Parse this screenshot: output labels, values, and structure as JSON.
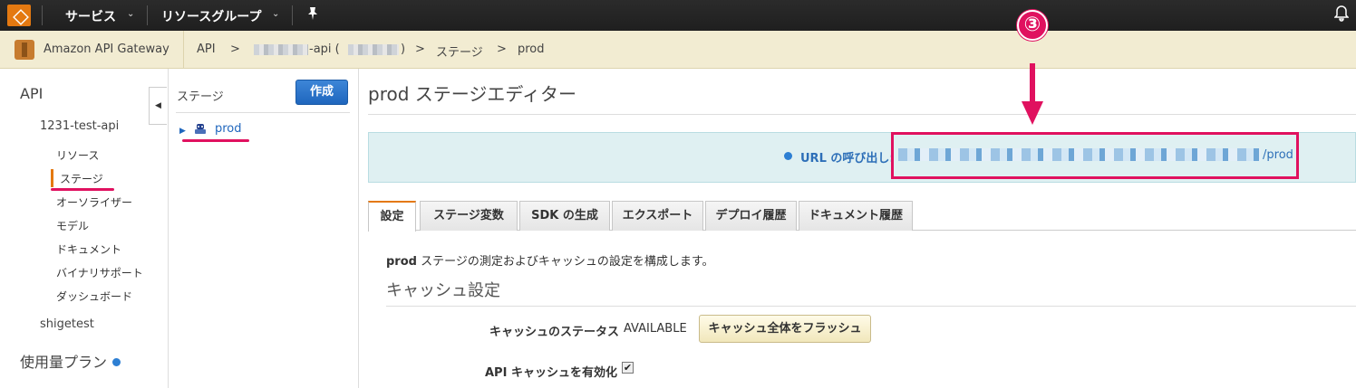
{
  "topnav": {
    "services_label": "サービス",
    "resource_groups_label": "リソースグループ",
    "chevron": "⌄",
    "pin_icon": "pin-icon",
    "bell_icon": "bell-icon"
  },
  "breadcrumb": {
    "service_name": "Amazon API Gateway",
    "items": [
      "API",
      ">",
      "-api (",
      ")",
      ">",
      "ステージ",
      ">",
      "prod"
    ]
  },
  "sidebar": {
    "section_api": "API",
    "api_name": "1231-test-api",
    "items": [
      {
        "label": "リソース"
      },
      {
        "label": "ステージ"
      },
      {
        "label": "オーソライザー"
      },
      {
        "label": "モデル"
      },
      {
        "label": "ドキュメント"
      },
      {
        "label": "バイナリサポート"
      },
      {
        "label": "ダッシュボード"
      }
    ],
    "other_api": "shigetest",
    "usage_plans": "使用量プラン",
    "collapse_glyph": "◀"
  },
  "stages": {
    "title": "ステージ",
    "create_label": "作成",
    "tree": [
      {
        "label": "prod"
      }
    ]
  },
  "main": {
    "title": "prod ステージエディター",
    "url": {
      "label": "URL の呼び出し:",
      "suffix": "/prod"
    },
    "annotation_number": "③",
    "tabs": [
      {
        "label": "設定",
        "active": true
      },
      {
        "label": "ステージ変数"
      },
      {
        "label": "SDK の生成"
      },
      {
        "label": "エクスポート"
      },
      {
        "label": "デプロイ履歴"
      },
      {
        "label": "ドキュメント履歴"
      }
    ],
    "description_bold": "prod",
    "description_rest": " ステージの測定およびキャッシュの設定を構成します。",
    "cache_heading": "キャッシュ設定",
    "cache_status_label": "キャッシュのステータス",
    "cache_status_value": "AVAILABLE",
    "flush_button_label": "キャッシュ全体をフラッシュ",
    "api_cache_label": "API キャッシュを有効化",
    "api_cache_checked": true,
    "check_glyph": "✔"
  },
  "colors": {
    "accent_orange": "#e47911",
    "annotation_pink": "#e0115f",
    "link_blue": "#1f66bd",
    "primary_button": "#1f66bd"
  }
}
